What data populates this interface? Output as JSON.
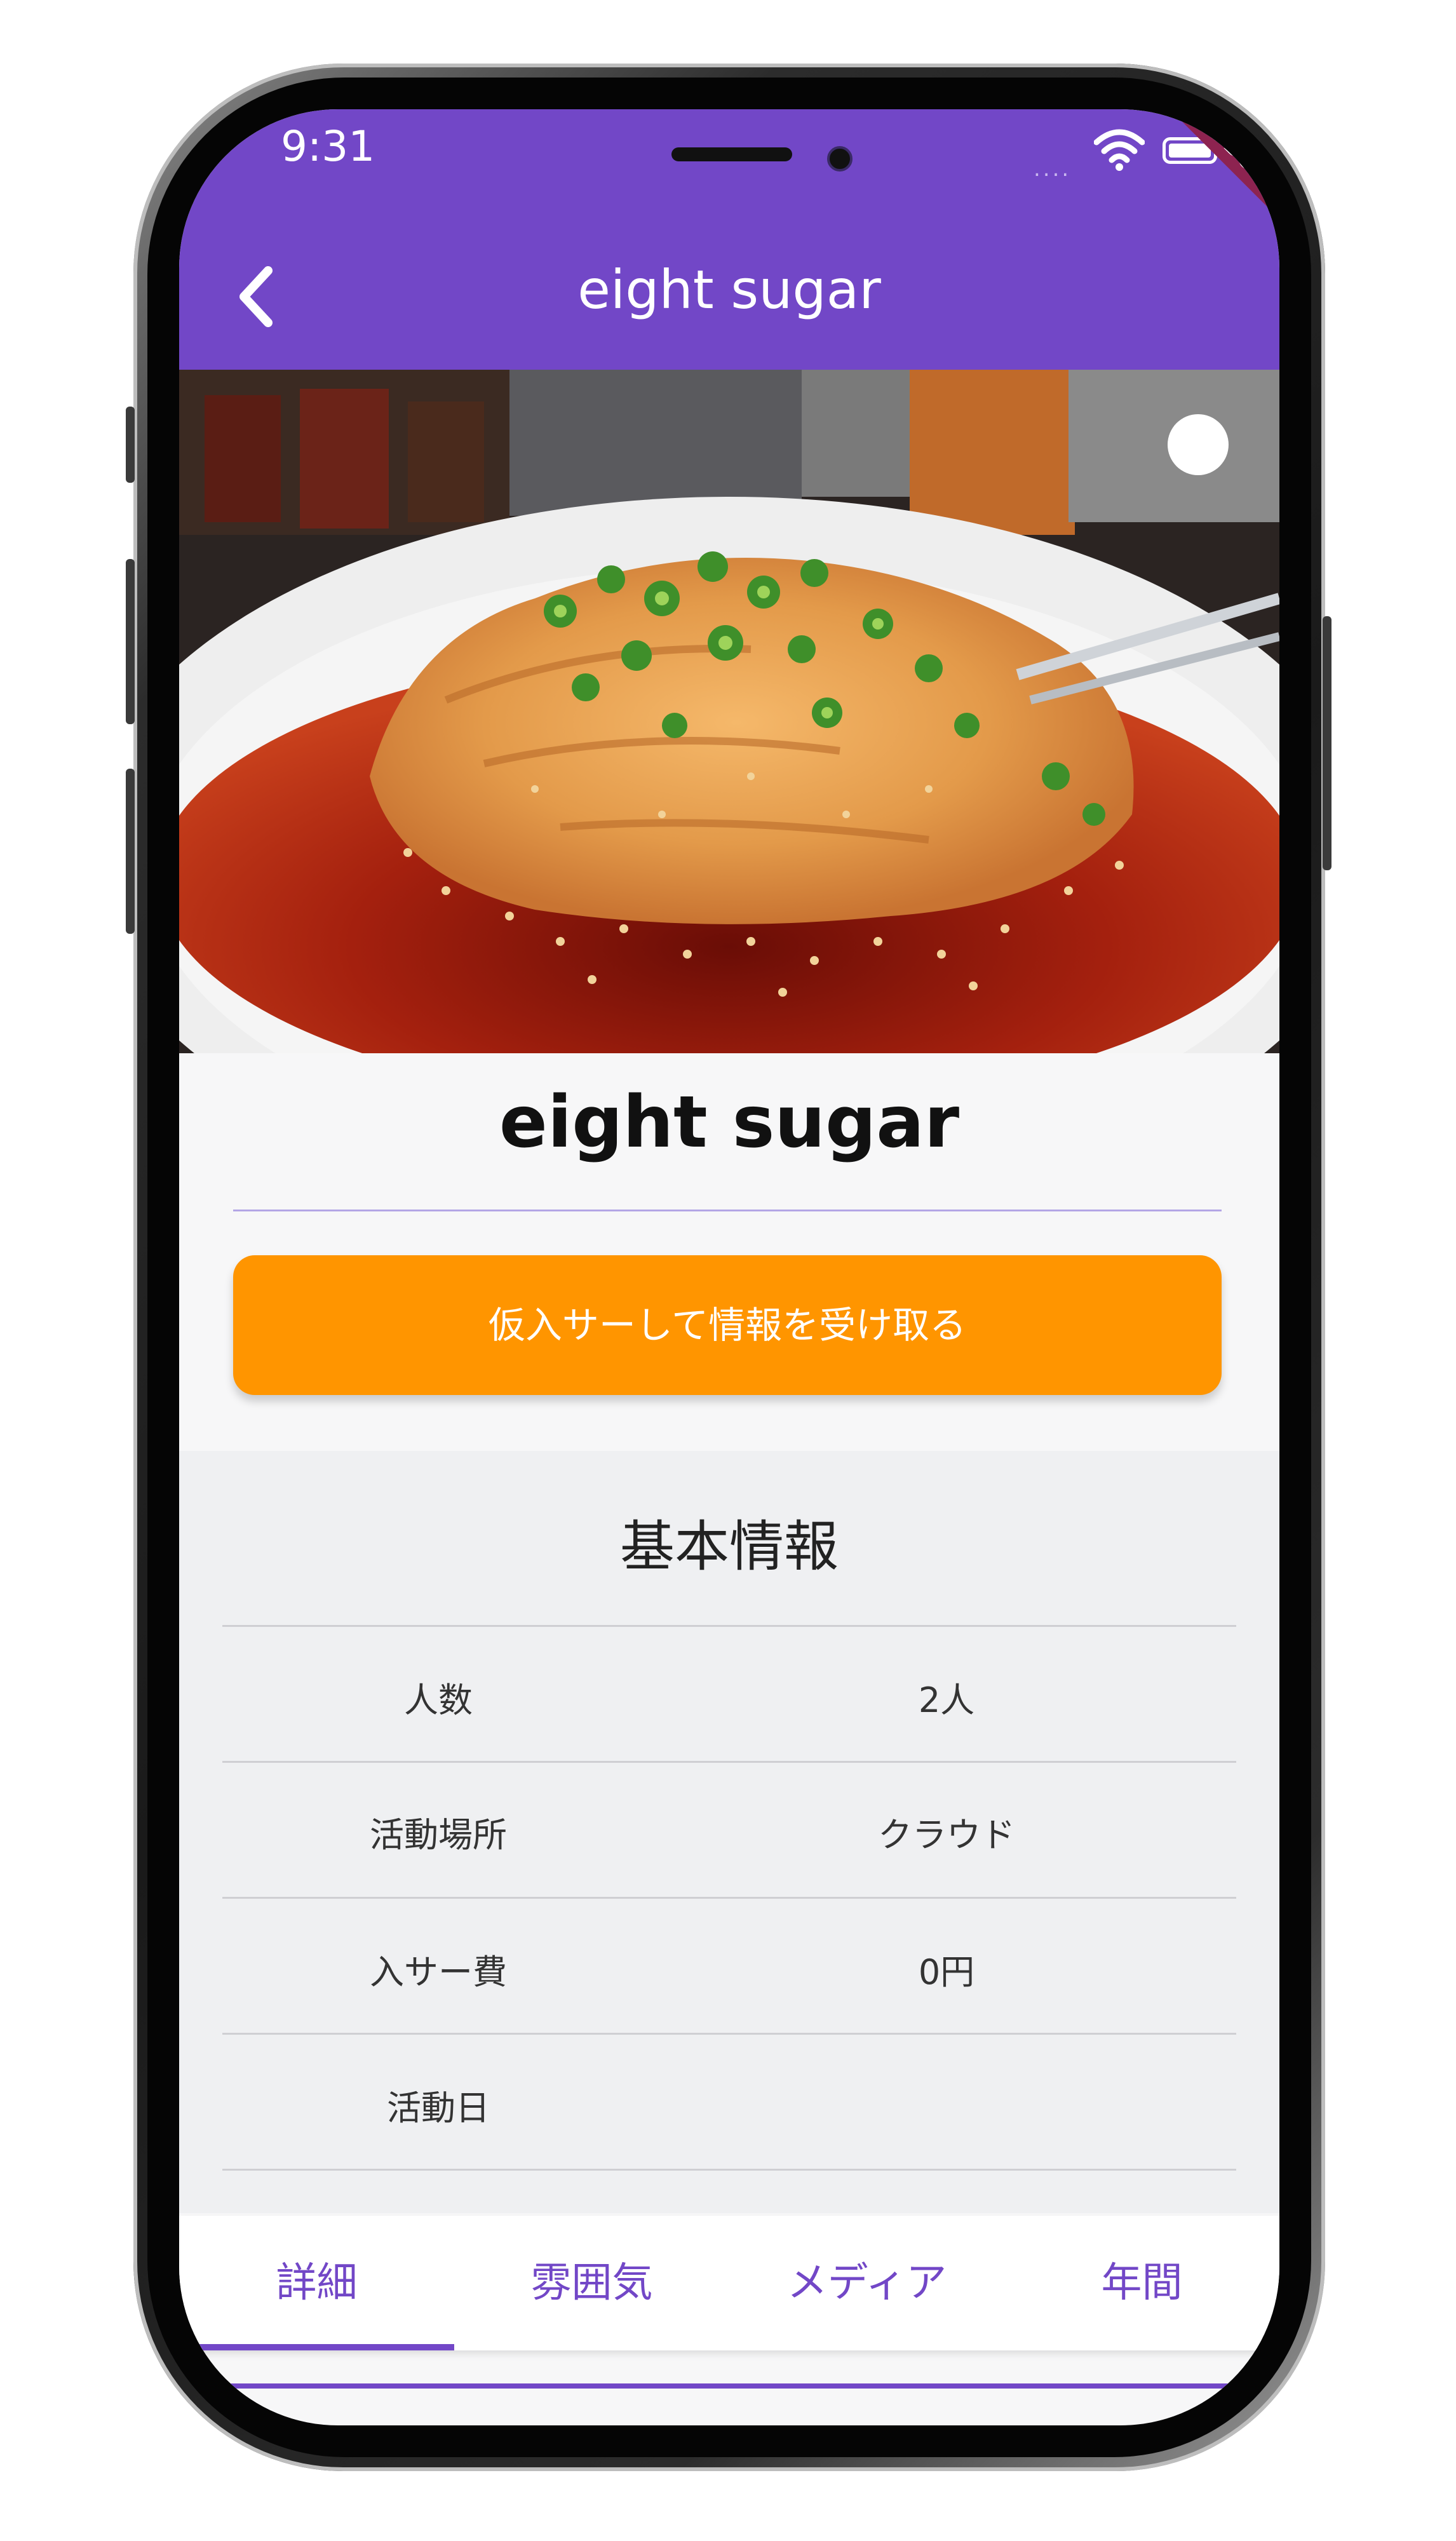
{
  "status_bar": {
    "time": "9:31",
    "signal": "....",
    "debug_banner": "DEBUG"
  },
  "app_bar": {
    "title": "eight sugar",
    "back_icon": "chevron-left-icon"
  },
  "hero": {
    "description": "photo of a spicy chicken dish with green onions and sesame seeds"
  },
  "club": {
    "name": "eight sugar"
  },
  "cta": {
    "label": "仮入サーして情報を受け取る",
    "color": "#ff9500"
  },
  "basic_info": {
    "title": "基本情報",
    "rows": [
      {
        "label": "人数",
        "value": "2人"
      },
      {
        "label": "活動場所",
        "value": "クラウド"
      },
      {
        "label": "入サー費",
        "value": "0円"
      },
      {
        "label": "活動日",
        "value": ""
      }
    ]
  },
  "tabs": [
    {
      "label": "詳細",
      "selected": true
    },
    {
      "label": "雰囲気",
      "selected": false
    },
    {
      "label": "メディア",
      "selected": false
    },
    {
      "label": "年間",
      "selected": false
    }
  ],
  "colors": {
    "primary": "#7247c7",
    "accent": "#ff9500",
    "info_bg": "#eff0f2"
  }
}
